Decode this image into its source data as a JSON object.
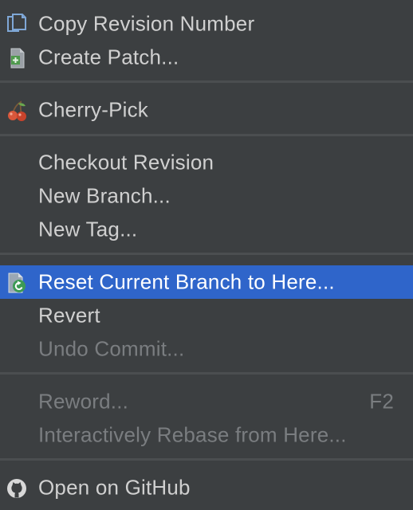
{
  "menu": {
    "items": [
      {
        "label": "Copy Revision Number",
        "icon": "copy-icon",
        "enabled": true
      },
      {
        "label": "Create Patch...",
        "icon": "patch-icon",
        "enabled": true
      },
      {
        "label": "Cherry-Pick",
        "icon": "cherry-icon",
        "enabled": true
      },
      {
        "label": "Checkout Revision",
        "enabled": true
      },
      {
        "label": "New Branch...",
        "enabled": true
      },
      {
        "label": "New Tag...",
        "enabled": true
      },
      {
        "label": "Reset Current Branch to Here...",
        "icon": "reset-icon",
        "enabled": true,
        "selected": true
      },
      {
        "label": "Revert",
        "enabled": true
      },
      {
        "label": "Undo Commit...",
        "enabled": false
      },
      {
        "label": "Reword...",
        "shortcut": "F2",
        "enabled": false
      },
      {
        "label": "Interactively Rebase from Here...",
        "enabled": false
      },
      {
        "label": "Open on GitHub",
        "icon": "github-icon",
        "enabled": true
      }
    ]
  },
  "colors": {
    "background": "#3c3f41",
    "selected": "#2f65ca",
    "text": "#d0d0d0",
    "disabled_text": "#7a7d80",
    "separator": "#4b4e50"
  }
}
